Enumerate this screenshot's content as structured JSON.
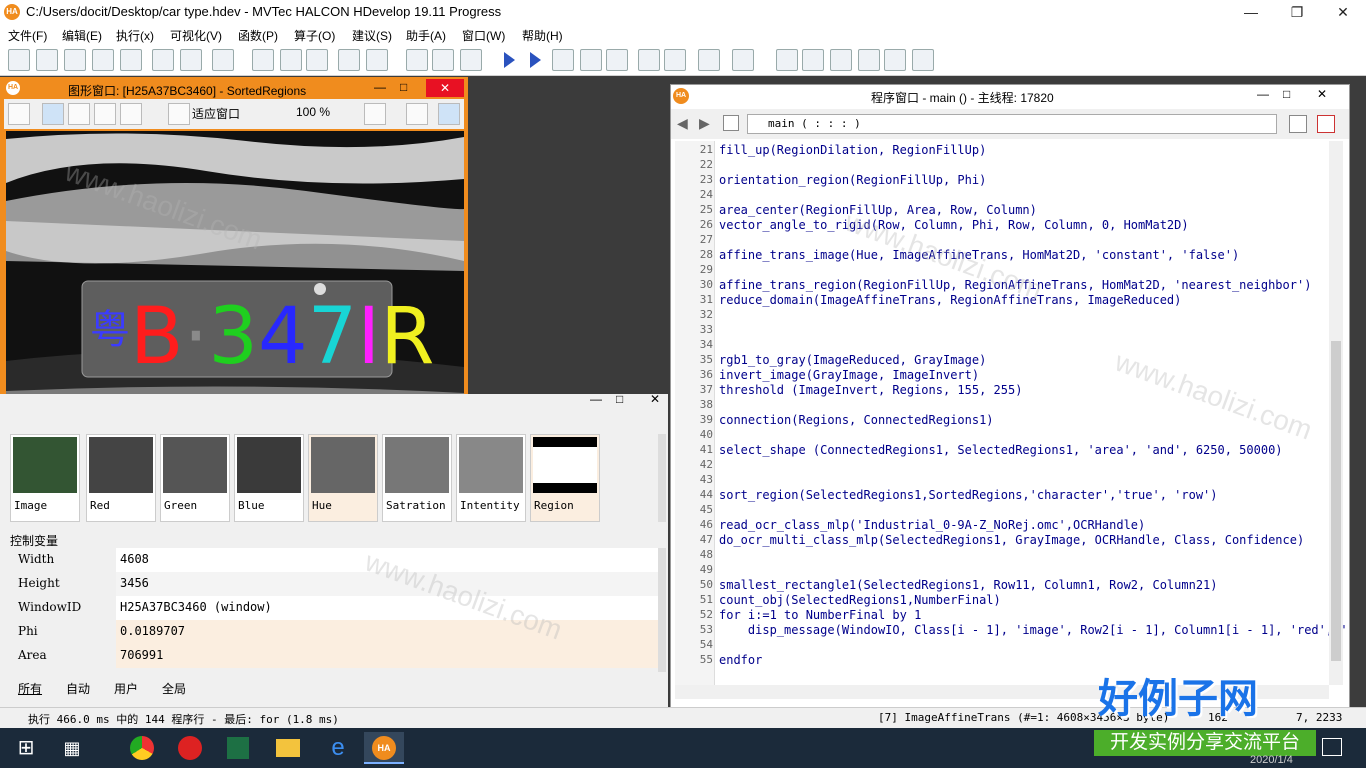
{
  "window": {
    "title": "C:/Users/docit/Desktop/car type.hdev - MVTec HALCON HDevelop 19.11 Progress",
    "logo": "HA"
  },
  "menu": [
    "文件(F)",
    "编辑(E)",
    "执行(x)",
    "可视化(V)",
    "函数(P)",
    "算子(O)",
    "建议(S)",
    "助手(A)",
    "窗口(W)",
    "帮助(H)"
  ],
  "graphics_window": {
    "title": "图形窗口: [H25A37BC3460] - SortedRegions",
    "fit_label": "适应窗口",
    "zoom_label": "100 %",
    "plate_text": "B·347IR",
    "plate_province": "粤"
  },
  "thumbnails": [
    "Image",
    "Red",
    "Green",
    "Blue",
    "Hue",
    "Satration",
    "Intentity",
    "Region"
  ],
  "variables": {
    "title": "控制变量",
    "rows": [
      {
        "name": "Width",
        "value": "4608"
      },
      {
        "name": "Height",
        "value": "3456"
      },
      {
        "name": "WindowID",
        "value": "H25A37BC3460 (window)"
      },
      {
        "name": "Phi",
        "value": "0.0189707"
      },
      {
        "name": "Area",
        "value": "706991"
      }
    ],
    "tabs": [
      "所有",
      "自动",
      "用户",
      "全局"
    ]
  },
  "program_window": {
    "title": "程序窗口 - main () - 主线程: 17820",
    "procedure": "main ( : : : )",
    "lines": [
      {
        "n": "21",
        "code": "fill_up(RegionDilation, RegionFillUp)"
      },
      {
        "n": "22",
        "code": ""
      },
      {
        "n": "23",
        "code": "orientation_region(RegionFillUp, Phi)"
      },
      {
        "n": "24",
        "code": ""
      },
      {
        "n": "25",
        "code": "area_center(RegionFillUp, Area, Row, Column)"
      },
      {
        "n": "26",
        "code": "vector_angle_to_rigid(Row, Column, Phi, Row, Column, 0, HomMat2D)"
      },
      {
        "n": "27",
        "code": ""
      },
      {
        "n": "28",
        "code": "affine_trans_image(Hue, ImageAffineTrans, HomMat2D, 'constant', 'false')"
      },
      {
        "n": "29",
        "code": ""
      },
      {
        "n": "30",
        "code": "affine_trans_region(RegionFillUp, RegionAffineTrans, HomMat2D, 'nearest_neighbor')"
      },
      {
        "n": "31",
        "code": "reduce_domain(ImageAffineTrans, RegionAffineTrans, ImageReduced)"
      },
      {
        "n": "32",
        "code": ""
      },
      {
        "n": "33",
        "code": ""
      },
      {
        "n": "34",
        "code": ""
      },
      {
        "n": "35",
        "code": "rgb1_to_gray(ImageReduced, GrayImage)"
      },
      {
        "n": "36",
        "code": "invert_image(GrayImage, ImageInvert)"
      },
      {
        "n": "37",
        "code": "threshold (ImageInvert, Regions, 155, 255)"
      },
      {
        "n": "38",
        "code": ""
      },
      {
        "n": "39",
        "code": "connection(Regions, ConnectedRegions1)"
      },
      {
        "n": "40",
        "code": ""
      },
      {
        "n": "41",
        "code": "select_shape (ConnectedRegions1, SelectedRegions1, 'area', 'and', 6250, 50000)"
      },
      {
        "n": "42",
        "code": ""
      },
      {
        "n": "43",
        "code": ""
      },
      {
        "n": "44",
        "code": "sort_region(SelectedRegions1,SortedRegions,'character','true', 'row')"
      },
      {
        "n": "45",
        "code": ""
      },
      {
        "n": "46",
        "code": "read_ocr_class_mlp('Industrial_0-9A-Z_NoRej.omc',OCRHandle)"
      },
      {
        "n": "47",
        "code": "do_ocr_multi_class_mlp(SelectedRegions1, GrayImage, OCRHandle, Class, Confidence)"
      },
      {
        "n": "48",
        "code": ""
      },
      {
        "n": "49",
        "code": ""
      },
      {
        "n": "50",
        "code": "smallest_rectangle1(SelectedRegions1, Row11, Column1, Row2, Column21)"
      },
      {
        "n": "51",
        "code": "count_obj(SelectedRegions1,NumberFinal)"
      },
      {
        "n": "52",
        "code": "for i:=1 to NumberFinal by 1"
      },
      {
        "n": "53",
        "code": "    disp_message(WindowIO, Class[i - 1], 'image', Row2[i - 1], Column1[i - 1], 'red', '"
      },
      {
        "n": "54",
        "code": ""
      },
      {
        "n": "55",
        "code": "endfor"
      }
    ]
  },
  "status": {
    "left": "执行 466.0 ms 中的 144 程序行 - 最后: for (1.8 ms)",
    "right": "[7] ImageAffineTrans (#=1: 4608×3456×3 byte)",
    "coords": "162",
    "coords2": "7, 2233"
  },
  "watermark": {
    "text": "www.haolizi.com",
    "brand": "好例子网",
    "slogan": "开发实例分享交流平台"
  },
  "taskbar": {
    "date": "2020/1/4"
  }
}
